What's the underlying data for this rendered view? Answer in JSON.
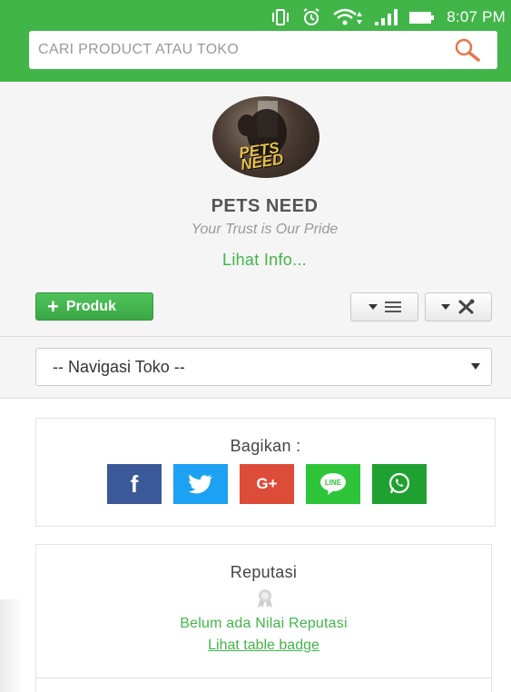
{
  "status_bar": {
    "time": "8:07 PM"
  },
  "search": {
    "placeholder": "CARI PRODUCT ATAU TOKO"
  },
  "shop": {
    "avatar_text": "PETS NEED",
    "name": "PETS NEED",
    "slogan": "Your Trust is Our Pride",
    "info_link": "Lihat Info..."
  },
  "toolbar": {
    "add_product_label": "Produk",
    "menu_icon": "hamburger-icon",
    "tools_icon": "tools-icon"
  },
  "nav": {
    "selected": "-- Navigasi Toko --"
  },
  "share": {
    "title": "Bagikan :",
    "buttons": [
      {
        "icon": "facebook-icon",
        "label": "f",
        "color": "#3b5998"
      },
      {
        "icon": "twitter-icon",
        "color": "#1da1f2"
      },
      {
        "icon": "google-plus-icon",
        "label": "G+",
        "color": "#dd4b39"
      },
      {
        "icon": "line-icon",
        "label": "LINE",
        "color": "#2ec43a"
      },
      {
        "icon": "whatsapp-icon",
        "color": "#1fa131"
      }
    ]
  },
  "reputation": {
    "title": "Reputasi",
    "empty_text": "Belum ada Nilai Reputasi",
    "badge_link": "Lihat table badge"
  },
  "colors": {
    "brand_green": "#42b549"
  }
}
